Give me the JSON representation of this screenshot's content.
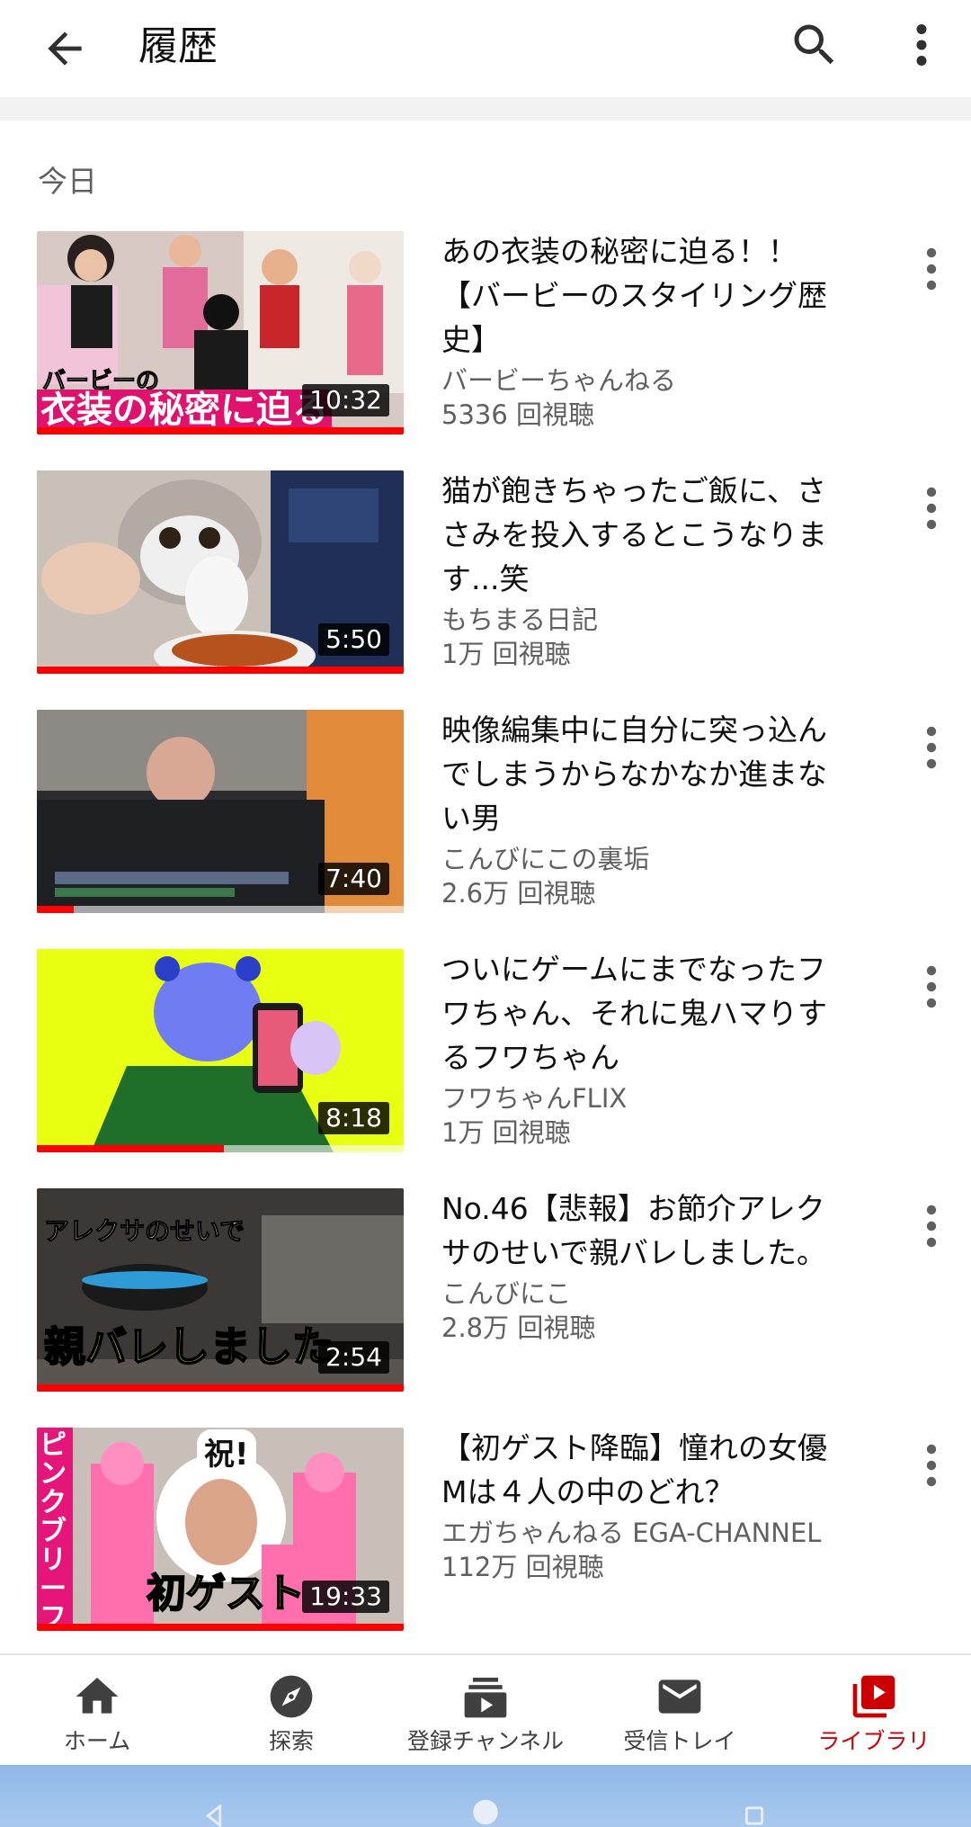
{
  "header": {
    "title": "履歴",
    "back_icon": "arrow-back-icon",
    "search_icon": "search-icon",
    "more_icon": "more-vert-icon"
  },
  "section": {
    "label": "今日"
  },
  "videos": [
    {
      "title_line1": "あの衣装の秘密に迫る！！",
      "title_line2": "【バービーのスタイリング歴",
      "title_line3": "史】",
      "channel": "バービーちゃんねる",
      "views": "5336 回視聴",
      "duration": "10:32",
      "progress": 1.0,
      "thumb_text": "衣装の秘密に迫る",
      "thumb_sub": "バービーの"
    },
    {
      "title_line1": "猫が飽きちゃったご飯に、さ",
      "title_line2": "さみを投入するとこうなりま",
      "title_line3": "す...笑",
      "channel": "もちまる日記",
      "views": "1万 回視聴",
      "duration": "5:50",
      "progress": 1.0
    },
    {
      "title_line1": "映像編集中に自分に突っ込ん",
      "title_line2": "でしまうからなかなか進まな",
      "title_line3": "い男",
      "channel": "こんびにこの裏垢",
      "views": "2.6万 回視聴",
      "duration": "7:40",
      "progress": 0.1
    },
    {
      "title_line1": "ついにゲームにまでなったフ",
      "title_line2": "ワちゃん、それに鬼ハマりす",
      "title_line3": "るフワちゃん",
      "channel": "フワちゃんFLIX",
      "views": "1万 回視聴",
      "duration": "8:18",
      "progress": 0.51
    },
    {
      "title_line1": "No.46【悲報】お節介アレク",
      "title_line2": "サのせいで親バレしました。",
      "title_line3": "",
      "channel": "こんびにこ",
      "views": "2.8万 回視聴",
      "duration": "2:54",
      "progress": 1.0,
      "thumb_text": "親バレしました",
      "thumb_sub": "アレクサのせいで"
    },
    {
      "title_line1": "【初ゲスト降臨】憧れの女優",
      "title_line2": "Mは４人の中のどれ？",
      "title_line3": "",
      "channel": "エガちゃんねる EGA-CHANNEL",
      "views": "112万 回視聴",
      "duration": "19:33",
      "progress": 1.0,
      "thumb_text": "初ゲスト",
      "thumb_sub": "祝!",
      "thumb_side": "ピンクブリーフ団"
    }
  ],
  "bottom_nav": [
    {
      "label": "ホーム",
      "icon": "home-icon"
    },
    {
      "label": "探索",
      "icon": "explore-icon"
    },
    {
      "label": "登録チャンネル",
      "icon": "subscriptions-icon"
    },
    {
      "label": "受信トレイ",
      "icon": "inbox-icon"
    },
    {
      "label": "ライブラリ",
      "icon": "library-icon",
      "active": true
    }
  ],
  "colors": {
    "accent": "#ff0000",
    "active_nav": "#cc0000",
    "secondary_text": "#606060"
  }
}
